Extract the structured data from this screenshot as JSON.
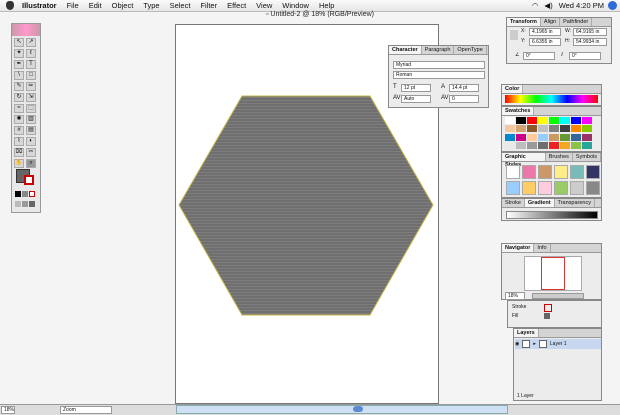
{
  "menubar": {
    "app": "Illustrator",
    "items": [
      "File",
      "Edit",
      "Object",
      "Type",
      "Select",
      "Filter",
      "Effect",
      "View",
      "Window",
      "Help"
    ],
    "clock": "Wed 4:20 PM"
  },
  "document": {
    "title": "Untitled-2 @ 18% (RGB/Preview)"
  },
  "transform": {
    "tabs": [
      "Transform",
      "Align",
      "Pathfinder"
    ],
    "x": "4.1965 in",
    "y": "6.6355 in",
    "w": "64.9165 in",
    "h": "54.9934 in",
    "rotate": "0°",
    "shear": "0°"
  },
  "character": {
    "tabs": [
      "Character",
      "Paragraph",
      "OpenType"
    ],
    "font": "Myriad",
    "style": "Roman",
    "size": "12 pt",
    "leading": "14.4 pt",
    "kerning": "Auto",
    "tracking": "0"
  },
  "color": {
    "title": "Color"
  },
  "swatches": {
    "title": "Swatches",
    "colors": [
      "#ffffff",
      "#000000",
      "#ff0000",
      "#ffff00",
      "#00ff00",
      "#00ffff",
      "#0000ff",
      "#ff00ff",
      "#f2c9a0",
      "#d4a373",
      "#8b5a2b",
      "#c0c0c0",
      "#808080",
      "#404040",
      "#ff8800",
      "#88cc00",
      "#0088cc",
      "#cc0088",
      "#ffcc99",
      "#99ccff",
      "#cc9966",
      "#669933",
      "#336699",
      "#993366",
      "#e9e9e9",
      "#bdbdbd",
      "#9a9a9a",
      "#6e6e6e",
      "#ee2222",
      "#f5a623",
      "#8bc34a",
      "#26a69a"
    ]
  },
  "styles": {
    "tabs": [
      "Graphic Styles",
      "Brushes",
      "Symbols"
    ]
  },
  "stroke": {
    "tabs": [
      "Stroke",
      "Gradient",
      "Transparency"
    ]
  },
  "navigator": {
    "tabs": [
      "Navigator",
      "Info"
    ],
    "zoom": "18%"
  },
  "appearance": {
    "labels": [
      "Stroke",
      "Fill"
    ]
  },
  "layers": {
    "title": "Layers",
    "layer_name": "Layer 1",
    "footer": "1 Layer"
  },
  "status": {
    "zoom": "18%",
    "tool": "Zoom"
  },
  "colors": {
    "hex_fill": "#6f6f6f",
    "hex_stroke": "#c8b84a",
    "accent": "#2e6bd8"
  }
}
